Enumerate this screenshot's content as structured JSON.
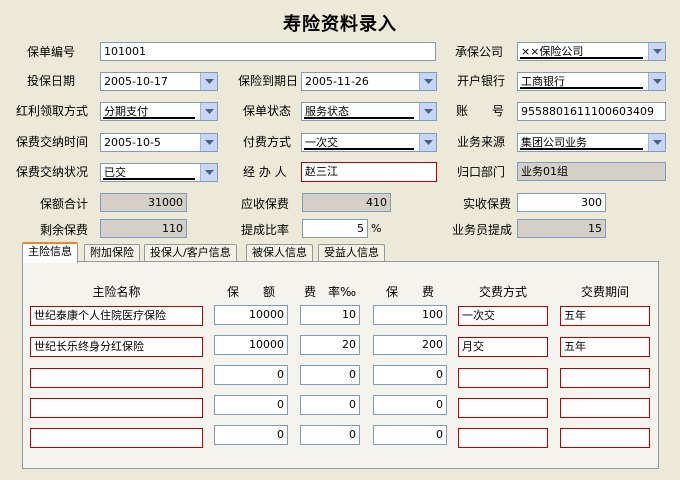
{
  "title": "寿险资料录入",
  "form": {
    "policy_no_label": "保单编号",
    "policy_no": "101001",
    "insurer_label": "承保公司",
    "insurer": "××保险公司",
    "insure_date_label": "投保日期",
    "insure_date": "2005-10-17",
    "expiry_label": "保险到期日",
    "expiry_date": "2005-11-26",
    "bank_label": "开户银行",
    "bank": "工商银行",
    "dividend_label": "红利领取方式",
    "dividend": "分期支付",
    "status_label": "保单状态",
    "status": "服务状态",
    "account_label": "账　　号",
    "account": "9558801611100603409",
    "pay_time_label": "保费交纳时间",
    "pay_time": "2005-10-5",
    "pay_method_label": "付费方式",
    "pay_method": "一次交",
    "source_label": "业务来源",
    "source": "集团公司业务",
    "pay_status_label": "保费交纳状况",
    "pay_status": "已交",
    "agent_label": "经 办 人",
    "agent": "赵三江",
    "dept_label": "归口部门",
    "dept": "业务01组",
    "total_label": "保额合计",
    "total": "31000",
    "receivable_label": "应收保费",
    "receivable": "410",
    "received_label": "实收保费",
    "received": "300",
    "remaining_label": "剩余保费",
    "remaining": "110",
    "rate_label": "提成比率",
    "rate": "5",
    "rate_unit": "%",
    "commission_label": "业务员提成",
    "commission": "15"
  },
  "tabs": [
    "主险信息",
    "附加保险",
    "投保人/客户信息",
    "被保人信息",
    "受益人信息"
  ],
  "table": {
    "headers": [
      "主险名称",
      "保　　额",
      "费　率‰",
      "保　　费",
      "交费方式",
      "交费期间"
    ],
    "rows": [
      {
        "name": "世纪泰康个人住院医疗保险",
        "amount": "10000",
        "rate": "10",
        "premium": "100",
        "method": "一次交",
        "period": "五年"
      },
      {
        "name": "世纪长乐终身分红保险",
        "amount": "10000",
        "rate": "20",
        "premium": "200",
        "method": "月交",
        "period": "五年"
      },
      {
        "name": "",
        "amount": "0",
        "rate": "0",
        "premium": "0",
        "method": "",
        "period": ""
      },
      {
        "name": "",
        "amount": "0",
        "rate": "0",
        "premium": "0",
        "method": "",
        "period": ""
      },
      {
        "name": "",
        "amount": "0",
        "rate": "0",
        "premium": "0",
        "method": "",
        "period": ""
      }
    ]
  }
}
